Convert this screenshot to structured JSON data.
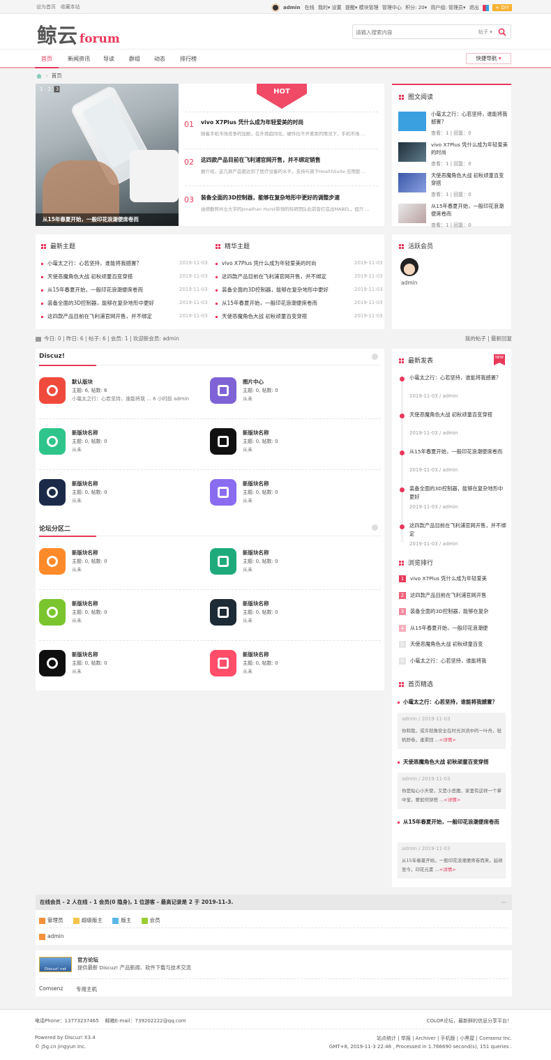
{
  "topbar": {
    "set_home": "设为首页",
    "favorite": "收藏本站",
    "user": "admin",
    "online": "在线",
    "mine": "我的",
    "settings": "设置",
    "remind": "提醒",
    "module_admin": "模块管理",
    "admin_center": "管理中心",
    "points": "积分: 20",
    "group": "用户组: 管理员",
    "logout": "退出",
    "diy": "DIY"
  },
  "header": {
    "logo_cn": "鲸云",
    "logo_en": "forum",
    "search_placeholder": "请输入搜索内容",
    "search_type": "帖子"
  },
  "nav": {
    "items": [
      "首页",
      "新闻资讯",
      "导读",
      "群组",
      "动态",
      "排行榜"
    ],
    "quick": "快捷导航"
  },
  "breadcrumb": {
    "home": "首页"
  },
  "slider": {
    "pages": [
      "1",
      "2",
      "3"
    ],
    "caption": "从15年春夏开始，一般印花浪潮便席卷而"
  },
  "hot": {
    "badge": "HOT",
    "items": [
      {
        "no": "01",
        "title": "vivo X7Plus 凭什么成为年轻爱美的时尚",
        "desc": "随着手机市场竞争的加剧，在外观趋同化、硬件拉不开差距的情况下，手机市场 ..."
      },
      {
        "no": "02",
        "title": "这四款产品目前在飞利浦官网开售，并不绑定销售",
        "desc": "据介绍，这几款产品都达到了医疗设备的水平，支持与旗下HealthSuite 应用配 ..."
      },
      {
        "no": "03",
        "title": "装备全面的3D控制器，能够在复杂地形中更好的调整步速",
        "desc": "由德勤阿州立大学的Jonathan Hurst带领的科研团队此前曾打造出MABEL，但只 ..."
      }
    ]
  },
  "picread": {
    "title": "图文阅读",
    "items": [
      {
        "title": "小鼋太之行：心若坚持，谁能将我撼置？",
        "views": "查看：1",
        "replies": "回复：0"
      },
      {
        "title": "vivo X7Plus 凭什么成为年轻爱美的时尚",
        "views": "查看：1",
        "replies": "回复：0"
      },
      {
        "title": "天使恶魔角色大战 初秋顽童百变穿搭",
        "views": "查看：1",
        "replies": "回复：0"
      },
      {
        "title": "从15年春夏开始，一般印花浪潮便席卷而",
        "views": "查看：1",
        "replies": "回复：0"
      }
    ]
  },
  "latest": {
    "title": "最新主题",
    "items": [
      {
        "t": "小鼋太之行：心若坚持，谁能将我撼置？",
        "d": "2019-11-03"
      },
      {
        "t": "天使恶魔角色大战 初秋顽童百变穿搭",
        "d": "2019-11-03"
      },
      {
        "t": "从15年春夏开始，一般印花浪潮便席卷而",
        "d": "2019-11-03"
      },
      {
        "t": "装备全面的3D控制器，能够在复杂地形中更好",
        "d": "2019-11-03"
      },
      {
        "t": "这四款产品目前在飞利浦官网开售，并不绑定",
        "d": "2019-11-03"
      }
    ]
  },
  "digest": {
    "title": "精华主题",
    "items": [
      {
        "t": "vivo X7Plus 凭什么成为年轻爱美的时尚",
        "d": "2019-11-03"
      },
      {
        "t": "这四款产品目前在飞利浦官网开售，并不绑定",
        "d": "2019-11-03"
      },
      {
        "t": "装备全面的3D控制器，能够在复杂地形中更好",
        "d": "2019-11-03"
      },
      {
        "t": "从15年春夏开始，一般印花浪潮便席卷而",
        "d": "2019-11-03"
      },
      {
        "t": "天使恶魔角色大战 初秋顽童百变穿搭",
        "d": "2019-11-03"
      }
    ]
  },
  "active": {
    "title": "活跃会员",
    "user": "admin"
  },
  "stats": {
    "text": "今日: 0 | 昨日: 6 | 帖子: 6 | 会员: 1 | 欢迎新会员: admin",
    "my_posts": "我的帖子",
    "latest_reply": "最新回复"
  },
  "forum1": {
    "title": "Discuz!",
    "boards": [
      {
        "name": "默认版块",
        "l1": "主题: 6, 帖数: 6",
        "l2": "小鼋太之行：心若坚持，谁能将我 ... 6 小时前 admin",
        "color": "#ef4a3c"
      },
      {
        "name": "图片中心",
        "l1": "主题: 0, 帖数: 0",
        "l2": "从未",
        "color": "#7f63d6"
      },
      {
        "name": "新版块名称",
        "l1": "主题: 0, 帖数: 0",
        "l2": "从未",
        "color": "#2ec48a"
      },
      {
        "name": "新版块名称",
        "l1": "主题: 0, 帖数: 0",
        "l2": "从未",
        "color": "#111111"
      },
      {
        "name": "新版块名称",
        "l1": "主题: 0, 帖数: 0",
        "l2": "从未",
        "color": "#1b2a48"
      },
      {
        "name": "新版块名称",
        "l1": "主题: 0, 帖数: 0",
        "l2": "从未",
        "color": "#8a6cf0"
      }
    ]
  },
  "forum2": {
    "title": "论坛分区二",
    "boards": [
      {
        "name": "新版块名称",
        "l1": "主题: 0, 帖数: 0",
        "l2": "从未",
        "color": "#ff8a2a"
      },
      {
        "name": "新版块名称",
        "l1": "主题: 0, 帖数: 0",
        "l2": "从未",
        "color": "#1faa7c"
      },
      {
        "name": "新版块名称",
        "l1": "主题: 0, 帖数: 0",
        "l2": "从未",
        "color": "#7ac52e"
      },
      {
        "name": "新版块名称",
        "l1": "主题: 0, 帖数: 0",
        "l2": "从未",
        "color": "#1d2b36"
      },
      {
        "name": "新版块名称",
        "l1": "主题: 0, 帖数: 0",
        "l2": "从未",
        "color": "#0f0f0f"
      },
      {
        "name": "新版块名称",
        "l1": "主题: 0, 帖数: 0",
        "l2": "从未",
        "color": "#ff4d6a"
      }
    ]
  },
  "newpost": {
    "title": "最新发表",
    "badge": "NEW",
    "items": [
      {
        "t": "小鼋太之行：心若坚持，谁能将我撼置？",
        "m": "2019-11-03 / admin"
      },
      {
        "t": "天使恶魔角色大战 初秋顽童百变穿搭",
        "m": "2019-11-03 / admin"
      },
      {
        "t": "从15年春夏开始，一般印花浪潮便席卷而",
        "m": "2019-11-03 / admin"
      },
      {
        "t": "装备全面的3D控制器，能够在复杂地形中更好",
        "m": "2019-11-03 / admin"
      },
      {
        "t": "这四款产品目前在飞利浦官网开售，并不绑定",
        "m": "2019-11-03 / admin"
      }
    ]
  },
  "rank": {
    "title": "浏览排行",
    "items": [
      {
        "n": "1",
        "t": "vivo X7Plus 凭什么成为年轻爱美"
      },
      {
        "n": "2",
        "t": "这四款产品目前在飞利浦官网开售"
      },
      {
        "n": "3",
        "t": "装备全面的3D控制器，能够在复杂"
      },
      {
        "n": "4",
        "t": "从15年春夏开始，一般印花浪潮便"
      },
      {
        "n": "5",
        "t": "天使恶魔角色大战 初秋顽童百变"
      },
      {
        "n": "6",
        "t": "小鼋太之行：心若坚持，谁能将我"
      }
    ]
  },
  "featured": {
    "title": "首页精选",
    "items": [
      {
        "t": "小鼋太之行：心若坚持，谁能将我撼置？",
        "m": "admin / 2019-11-03",
        "d": "你和我，或许就像安全在时光洪流中的一叶舟，轻帆舒卷，逢渠回 ...",
        "more": "<详情>"
      },
      {
        "t": "天使恶魔角色大战 初秋顽童百变穿搭",
        "m": "admin / 2019-11-03",
        "d": "你是贴心小天使，又是小恶魔，家里有这样一个掌中宝，要如何穿搭 ...",
        "more": "<详情>"
      },
      {
        "t": "从15年春夏开始，一般印花浪潮便席卷而",
        "m": "admin / 2019-11-03",
        "d": "从15年春夏开始，一般印花浪潮便席卷而来，延续至今，印花元素 ...",
        "more": "<详情>"
      }
    ]
  },
  "online": {
    "title": "在线会员 - 2 人在线 - 1 会员(0 隐身), 1 位游客 - 最高记录是 2 于 2019-11-3.",
    "legend": [
      "管理员",
      "超级版主",
      "版主",
      "会员"
    ],
    "user": "admin"
  },
  "links": {
    "name": "官方论坛",
    "desc": "提供最新 Discuz! 产品新闻、软件下载与技术交流",
    "logo": "Discuz! net",
    "items": [
      "Comsenz",
      "专用主机"
    ]
  },
  "footer": {
    "phone": "电话Phone：13773237465",
    "email": "邮箱E-mail：739202222@qq.com",
    "slogan": "COLOR论坛，最新鲜的信息分享平台！",
    "powered": "Powered by Discuz! X3.4",
    "copy": "© j5g.cn jingyun Inc.",
    "flinks": "站点统计 | 举报 | Archiver | 手机版 | 小黑屋 | Comsenz Inc.",
    "gmt": "GMT+8, 2019-11-3 22:46 , Processed in 1.766690 second(s), 151 queries ."
  }
}
